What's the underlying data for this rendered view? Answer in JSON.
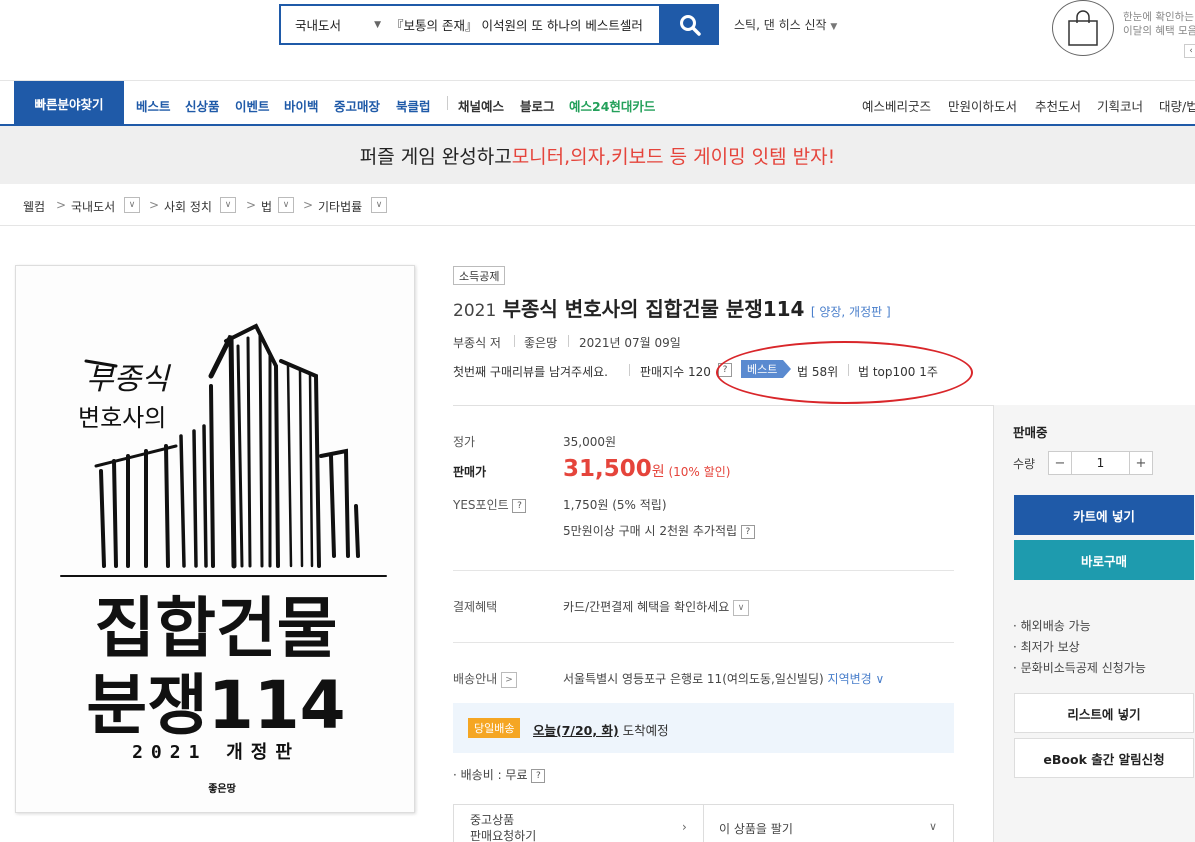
{
  "search": {
    "category": "국내도서",
    "query": "『보통의 존재』 이석원의 또 하나의 베스트셀러",
    "keyword": "스틱, 댄 히스 신작"
  },
  "top_promo": {
    "line1": "한눈에 확인하는",
    "line2": "이달의 혜택 모음",
    "arrow": "‹"
  },
  "nav": {
    "quick": "빠른분야찾기",
    "items": [
      "베스트",
      "신상품",
      "이벤트",
      "바이백",
      "중고매장",
      "북클럽"
    ],
    "items2": [
      "채널예스",
      "블로그"
    ],
    "card": "예스24현대카드",
    "right": [
      "예스베리굿즈",
      "만원이하도서",
      "추천도서",
      "기획코너",
      "대량/법인"
    ]
  },
  "banner": {
    "text": "퍼즐 게임 완성하고 ",
    "highlight": "모니터,의자,키보드 등 게이밍 잇템 받자!"
  },
  "breadcrumb": [
    "웰컴",
    "국내도서",
    "사회 정치",
    "법",
    "기타법률"
  ],
  "cover": {
    "author_hand": "부종식",
    "lawyer": "변호사의",
    "title1": "집합건물",
    "title2": "분쟁114",
    "edition": "2021 개정판",
    "publisher": "좋은땅"
  },
  "book": {
    "tag": "소득공제",
    "year": "2021",
    "title": "부종식 변호사의 집합건물 분쟁114",
    "edition": "[ 양장, 개정판 ]",
    "author": "부종식 저",
    "publisher": "좋은땅",
    "date": "2021년 07월 09일",
    "review": "첫번째 구매리뷰를 남겨주세요.",
    "sales_index": "판매지수 120",
    "best_badge": "베스트",
    "rank1": "법 58위",
    "rank2": "법 top100 1주"
  },
  "price": {
    "list_label": "정가",
    "list_value": "35,000원",
    "sale_label": "판매가",
    "sale_number": "31,500",
    "sale_unit": "원",
    "discount": "(10% 할인)",
    "points_label": "YES포인트",
    "points_value": "1,750원 (5% 적립)",
    "extra": "5만원이상 구매 시 2천원 추가적립",
    "payment_label": "결제혜택",
    "payment_value": "카드/간편결제 혜택을 확인하세요",
    "delivery_label": "배송안내",
    "delivery_address": "서울특별시 영등포구 은행로 11(여의도동,일신빌딩)",
    "region_change": "지역변경",
    "sameday_badge": "당일배송",
    "sameday_date": "오늘(7/20, 화)",
    "sameday_suffix": " 도착예정",
    "shipping_fee": "· 배송비 : 무료",
    "used_line1": "중고상품",
    "used_line2": "판매요청하기",
    "sell": "이 상품을 팔기"
  },
  "panel": {
    "status": "판매중",
    "qty_label": "수량",
    "qty_value": "1",
    "minus": "−",
    "plus": "+",
    "cart": "카트에 넣기",
    "buy": "바로구매",
    "bullets": [
      "· 해외배송 가능",
      "· 최저가 보상",
      "· 문화비소득공제 신청가능"
    ],
    "wishlist": "리스트에 넣기",
    "ebook": "eBook 출간 알림신청"
  },
  "colors": {
    "brand": "#1f5aa8",
    "accent": "#e5443b",
    "buy": "#1e9bae",
    "sameday": "#f5a623",
    "annotation": "#d9262a"
  }
}
